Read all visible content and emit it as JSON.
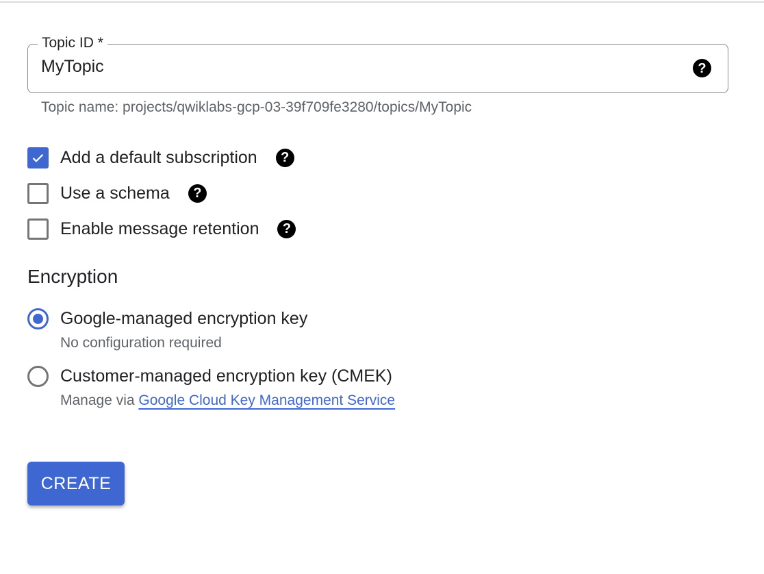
{
  "topic_field": {
    "label": "Topic ID *",
    "value": "MyTopic",
    "help_icon": "help-circle-icon",
    "hint": "Topic name: projects/qwiklabs-gcp-03-39f709fe3280/topics/MyTopic"
  },
  "options": [
    {
      "label": "Add a default subscription",
      "checked": true,
      "help_icon": "help-circle-icon"
    },
    {
      "label": "Use a schema",
      "checked": false,
      "help_icon": "help-circle-icon"
    },
    {
      "label": "Enable message retention",
      "checked": false,
      "help_icon": "help-circle-icon"
    }
  ],
  "encryption": {
    "title": "Encryption",
    "choices": [
      {
        "label": "Google-managed encryption key",
        "selected": true,
        "sub": "No configuration required"
      },
      {
        "label": "Customer-managed encryption key (CMEK)",
        "selected": false,
        "sub_prefix": "Manage via ",
        "sub_link": "Google Cloud Key Management Service"
      }
    ]
  },
  "actions": {
    "create_label": "CREATE"
  },
  "colors": {
    "accent": "#3f67d1",
    "border": "#80868b",
    "hint": "#5f6368"
  }
}
